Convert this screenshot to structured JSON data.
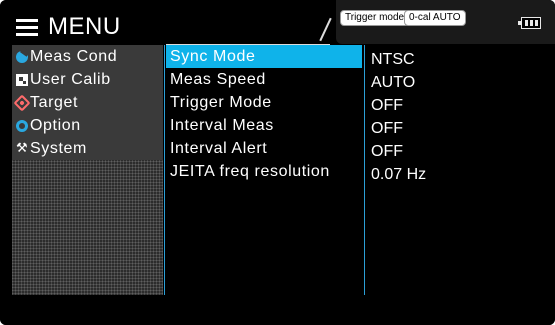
{
  "header": {
    "menu_title": "MENU",
    "hamburger_icon": "menu-icon"
  },
  "status": {
    "trigger_label": "Trigger mode",
    "cal_label": "0-cal AUTO",
    "battery_icon": "battery-icon"
  },
  "categories": [
    {
      "label": "Meas Cond",
      "icon": "meas-cond-icon",
      "color": "#2aa8e0"
    },
    {
      "label": "User Calib",
      "icon": "user-calib-icon",
      "color": "#ffffff"
    },
    {
      "label": "Target",
      "icon": "target-icon",
      "color": "#ff6b6b"
    },
    {
      "label": "Option",
      "icon": "option-icon",
      "color": "#2aa8e0"
    },
    {
      "label": "System",
      "icon": "system-icon",
      "color": "#ffffff"
    }
  ],
  "settings": [
    {
      "label": "Sync Mode",
      "value": "NTSC"
    },
    {
      "label": "Meas Speed",
      "value": "AUTO"
    },
    {
      "label": "Trigger Mode",
      "value": "OFF"
    },
    {
      "label": "Interval Meas",
      "value": "OFF"
    },
    {
      "label": "Interval Alert",
      "value": "OFF"
    },
    {
      "label": "JEITA freq resolution",
      "value": "0.07 Hz"
    }
  ],
  "colors": {
    "accent": "#0fb3ea",
    "separator": "#2b9fd6",
    "background": "#000000",
    "panel": "#3a3a3a"
  }
}
